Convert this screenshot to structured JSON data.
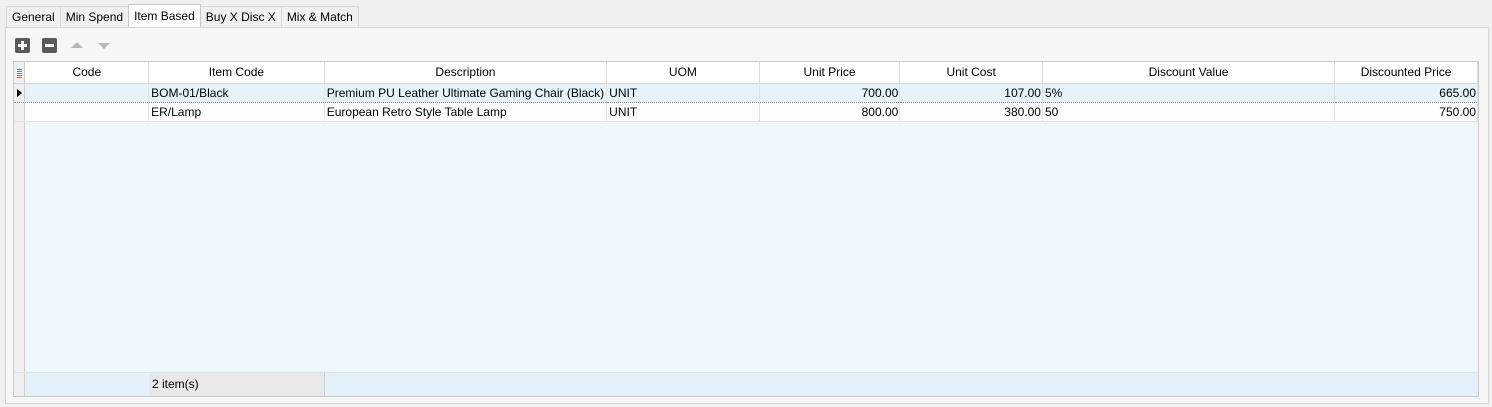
{
  "tabs": [
    {
      "label": "General",
      "active": false
    },
    {
      "label": "Min Spend",
      "active": false
    },
    {
      "label": "Item Based",
      "active": true
    },
    {
      "label": "Buy X Disc X",
      "active": false
    },
    {
      "label": "Mix & Match",
      "active": false
    }
  ],
  "toolbar": {
    "add_icon": "plus-square-icon",
    "remove_icon": "minus-square-icon",
    "move_up_icon": "triangle-up-icon",
    "move_down_icon": "triangle-down-icon"
  },
  "grid": {
    "columns": [
      "Code",
      "Item Code",
      "Description",
      "UOM",
      "Unit Price",
      "Unit Cost",
      "Discount Value",
      "Discounted Price"
    ],
    "rows": [
      {
        "code": "",
        "item_code": "BOM-01/Black",
        "description": "Premium PU Leather Ultimate Gaming Chair (Black)",
        "uom": "UNIT",
        "unit_price": "700.00",
        "unit_cost": "107.00",
        "discount_value": "5%",
        "discounted_price": "665.00",
        "selected": true
      },
      {
        "code": "",
        "item_code": "ER/Lamp",
        "description": "European Retro Style Table Lamp",
        "uom": "UNIT",
        "unit_price": "800.00",
        "unit_cost": "380.00",
        "discount_value": "50",
        "discounted_price": "750.00",
        "selected": false
      }
    ],
    "footer_count": "2 item(s)"
  }
}
